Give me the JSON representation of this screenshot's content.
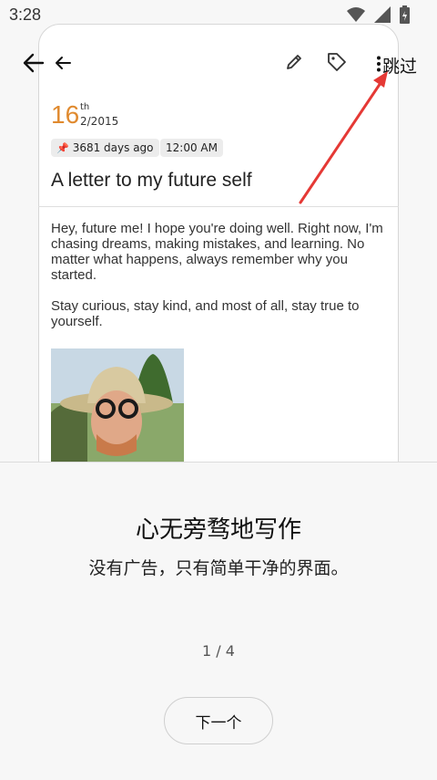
{
  "status_bar": {
    "time": "3:28",
    "icons": [
      "wifi-icon",
      "signal-icon",
      "battery-icon"
    ]
  },
  "toolbar": {
    "back_icon": "back-arrow-icon",
    "nav_icon": "arrow-left-icon",
    "edit_icon": "pencil-icon",
    "tag_icon": "tag-icon",
    "more_icon": "more-vertical-icon",
    "skip_label": "跳过"
  },
  "entry": {
    "day": "16",
    "day_suffix": "th",
    "month_year": "2/2015",
    "days_ago": "3681 days ago",
    "time": "12:00 AM",
    "title": "A letter to my future self",
    "paragraphs": [
      "Hey, future me! I hope you're doing well. Right now, I'm chasing dreams, making mistakes, and learning. No matter what happens, always remember why you started.",
      "Stay curious, stay kind, and most of all, stay true to yourself."
    ],
    "photo_icon": "photo-man-with-hat"
  },
  "onboarding": {
    "headline": "心无旁骛地写作",
    "subline": "没有广告，只有简单干净的界面。",
    "page_indicator": "1 / 4",
    "next_label": "下一个"
  },
  "colors": {
    "date_accent": "#e08a2f",
    "annotation_arrow": "#e53935",
    "background": "#f7f7f7"
  }
}
